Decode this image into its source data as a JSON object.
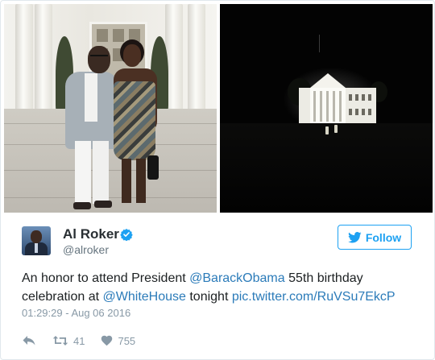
{
  "tweet": {
    "author_name": "Al Roker",
    "handle": "@alroker",
    "follow_label": "Follow",
    "text_parts": {
      "t1": "An honor to attend President ",
      "mention1": "@BarackObama",
      "t2": " 55th birthday celebration at ",
      "mention2": "@WhiteHouse",
      "t3": " tonight ",
      "pic_link": "pic.twitter.com/RuVSu7EkcP"
    },
    "timestamp": "01:29:29 - Aug 06 2016",
    "retweet_count": "41",
    "like_count": "755"
  },
  "icons": {
    "verified": "verified-badge-icon",
    "follow": "twitter-bird-icon",
    "reply": "reply-icon",
    "retweet": "retweet-icon",
    "like": "heart-icon"
  },
  "colors": {
    "accent": "#1da1f2",
    "link": "#2b7bb9",
    "muted": "#8899a6",
    "text": "#1c2022"
  }
}
